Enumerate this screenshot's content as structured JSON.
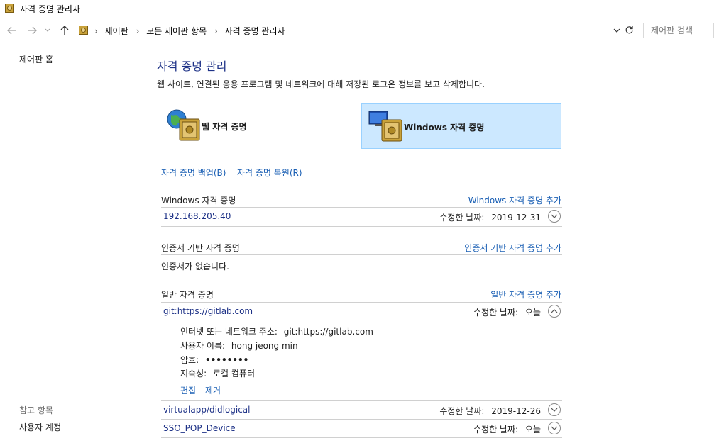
{
  "window": {
    "title": "자격 증명 관리자"
  },
  "nav": {
    "crumbs": [
      "제어판",
      "모든 제어판 항목",
      "자격 증명 관리자"
    ],
    "search_placeholder": "제어판 검색"
  },
  "left": {
    "home": "제어판 홈",
    "see_also_header": "참고 항목",
    "user_accounts": "사용자 계정"
  },
  "main": {
    "title": "자격 증명 관리",
    "description": "웹 사이트, 연결된 응용 프로그램 및 네트워크에 대해 저장된 로그온 정보를 보고 삭제합니다.",
    "tiles": [
      {
        "label": "웹 자격 증명",
        "selected": false
      },
      {
        "label": "Windows 자격 증명",
        "selected": true
      }
    ],
    "backup_link": "자격 증명 백업(B)",
    "restore_link": "자격 증명 복원(R)",
    "modified_label": "수정한 날짜:",
    "sections": {
      "windows": {
        "header": "Windows 자격 증명",
        "add": "Windows 자격 증명 추가",
        "items": [
          {
            "name": "192.168.205.40",
            "date": "2019-12-31"
          }
        ]
      },
      "certificate": {
        "header": "인증서 기반 자격 증명",
        "add": "인증서 기반 자격 증명 추가",
        "empty": "인증서가 없습니다."
      },
      "generic": {
        "header": "일반 자격 증명",
        "add": "일반 자격 증명 추가",
        "expanded": {
          "name": "git:https://gitlab.com",
          "date": "오늘",
          "address_label": "인터넷 또는 네트워크 주소:",
          "address": "git:https://gitlab.com",
          "user_label": "사용자 이름:",
          "user": "hong jeong min",
          "password_label": "암호:",
          "password": "••••••••",
          "persistence_label": "지속성:",
          "persistence": "로컬 컴퓨터",
          "edit": "편집",
          "remove": "제거"
        },
        "items": [
          {
            "name": "virtualapp/didlogical",
            "date": "2019-12-26"
          },
          {
            "name": "SSO_POP_Device",
            "date": "오늘"
          }
        ]
      }
    }
  },
  "colors": {
    "accent": "#1a5fb4",
    "heading": "#1e3287",
    "selected_tile": "#cce8ff"
  }
}
